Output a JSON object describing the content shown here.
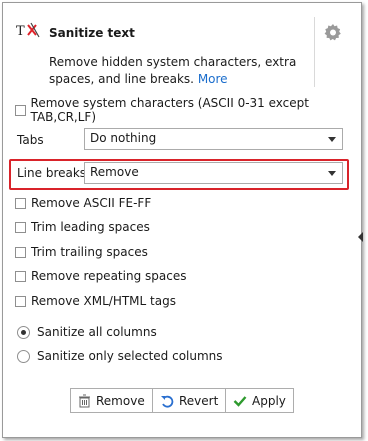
{
  "header": {
    "title": "Sanitize text",
    "description": "Remove hidden system characters, extra spaces, and line breaks.",
    "more_link": "More"
  },
  "options": {
    "remove_system_chars": {
      "label": "Remove system characters (ASCII 0-31 except TAB,CR,LF)",
      "checked": false
    },
    "tabs": {
      "label": "Tabs",
      "value": "Do nothing"
    },
    "line_breaks": {
      "label": "Line breaks",
      "value": "Remove"
    },
    "remove_ascii": {
      "label": "Remove ASCII FE-FF",
      "checked": false
    },
    "trim_leading": {
      "label": "Trim leading spaces",
      "checked": false
    },
    "trim_trailing": {
      "label": "Trim trailing spaces",
      "checked": false
    },
    "remove_repeating": {
      "label": "Remove repeating spaces",
      "checked": false
    },
    "remove_xml": {
      "label": "Remove XML/HTML tags",
      "checked": false
    }
  },
  "scope": {
    "all_columns": {
      "label": "Sanitize all columns",
      "selected": true
    },
    "selected_columns": {
      "label": "Sanitize only selected columns",
      "selected": false
    }
  },
  "buttons": {
    "remove": "Remove",
    "revert": "Revert",
    "apply": "Apply"
  },
  "colors": {
    "highlight": "#d9232a",
    "link": "#1a6dcc",
    "apply_check": "#2e9a2e",
    "revert_arrow": "#2a6fcf"
  },
  "icons": [
    "mouse-cursor-icon",
    "app-icon",
    "gear-icon",
    "trash-icon",
    "undo-icon",
    "checkmark-icon",
    "chevron-down-icon",
    "expand-arrow-icon"
  ]
}
